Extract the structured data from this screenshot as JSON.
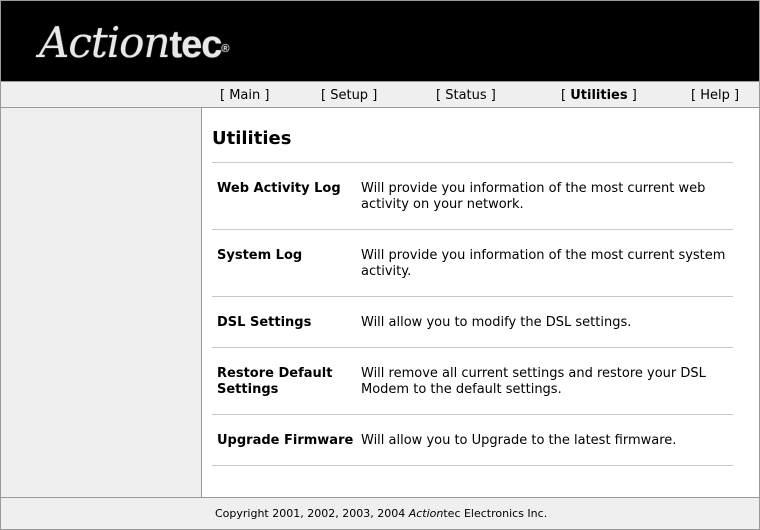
{
  "brand": {
    "logo_script": "Action",
    "logo_plain": "tec",
    "logo_reg": "®",
    "colors": {
      "header_bg": "#000000",
      "nav_bg": "#efefef",
      "text": "#000000"
    }
  },
  "nav": {
    "items": [
      {
        "label": "Main"
      },
      {
        "label": "Setup"
      },
      {
        "label": "Status"
      },
      {
        "label": "Utilities",
        "active": true
      },
      {
        "label": "Help"
      }
    ]
  },
  "page": {
    "title": "Utilities"
  },
  "utilities": [
    {
      "name_line1": "Web Activity Log",
      "name_line2": "",
      "desc_line1": "Will provide you information of the most current web",
      "desc_line2": "activity on your network."
    },
    {
      "name_line1": "System Log",
      "name_line2": "",
      "desc_line1": "Will provide you information of the most current system",
      "desc_line2": "activity."
    },
    {
      "name_line1": "DSL Settings",
      "name_line2": "",
      "desc_line1": "Will allow you to modify the DSL settings.",
      "desc_line2": ""
    },
    {
      "name_line1": "Restore Default",
      "name_line2": "Settings",
      "desc_line1": "Will remove all current settings and restore your DSL",
      "desc_line2": "Modem to the default settings."
    },
    {
      "name_line1": "Upgrade Firmware",
      "name_line2": "",
      "desc_line1": "Will allow you to Upgrade to the latest firmware.",
      "desc_line2": ""
    }
  ],
  "footer": {
    "copyright_prefix": "Copyright 2001, 2002, 2003, 2004 ",
    "copyright_brand_italic": "Action",
    "copyright_suffix": "tec Electronics Inc."
  }
}
